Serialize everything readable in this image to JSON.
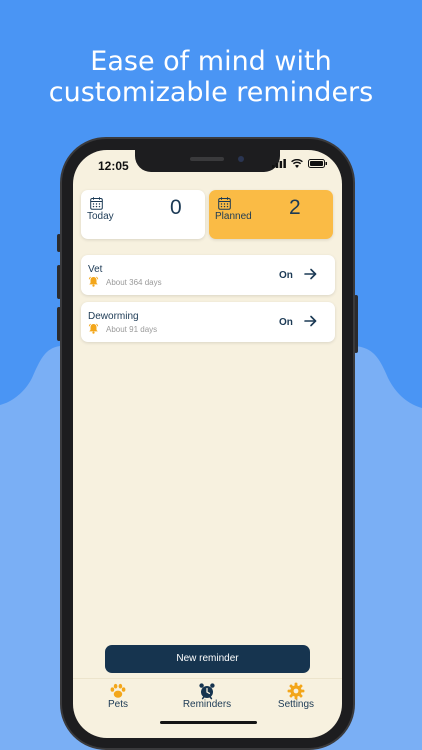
{
  "headline": {
    "line1": "Ease of mind with",
    "line2": "customizable reminders"
  },
  "colors": {
    "background_blue": "#4a95f4",
    "lower_blue": "#7aaff5",
    "screen_bg": "#f7f1df",
    "planned_card": "#fabb45",
    "accent_orange": "#f3a61a",
    "navy": "#16344f"
  },
  "status_bar": {
    "time": "12:05",
    "icons": [
      "signal-icon",
      "wifi-icon",
      "battery-icon"
    ]
  },
  "summary": {
    "today": {
      "label": "Today",
      "count": "0",
      "icon": "calendar-icon"
    },
    "planned": {
      "label": "Planned",
      "count": "2",
      "icon": "calendar-icon"
    }
  },
  "reminders": [
    {
      "title": "Vet",
      "subtitle": "About 364 days",
      "state": "On",
      "icon": "bell-icon"
    },
    {
      "title": "Deworming",
      "subtitle": "About 91 days",
      "state": "On",
      "icon": "bell-icon"
    }
  ],
  "new_reminder_label": "New reminder",
  "tabs": [
    {
      "label": "Pets",
      "icon": "paw-icon"
    },
    {
      "label": "Reminders",
      "icon": "alarm-clock-icon"
    },
    {
      "label": "Settings",
      "icon": "gear-icon"
    }
  ]
}
